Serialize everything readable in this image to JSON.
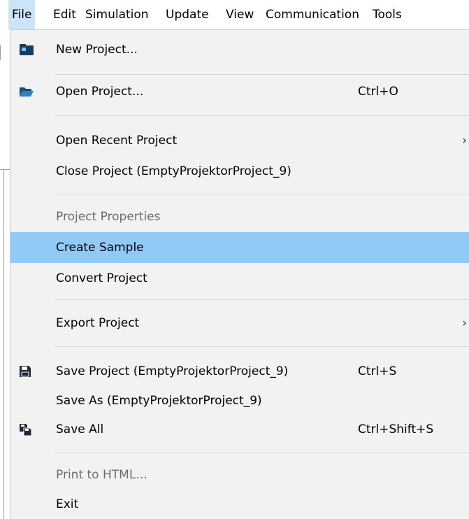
{
  "menubar": {
    "items": [
      {
        "label": "File"
      },
      {
        "label": "Edit"
      },
      {
        "label": "Simulation"
      },
      {
        "label": "Update"
      },
      {
        "label": "View"
      },
      {
        "label": "Communication"
      },
      {
        "label": "Tools"
      }
    ],
    "active_item": "File"
  },
  "file_menu": {
    "new_project": {
      "label": "New Project...",
      "icon": "new-project-icon"
    },
    "open_project": {
      "label": "Open Project...",
      "shortcut": "Ctrl+O",
      "icon": "folder-open-icon"
    },
    "open_recent_project": {
      "label": "Open Recent Project",
      "has_submenu": true
    },
    "close_project": {
      "label": "Close Project (EmptyProjektorProject_9)"
    },
    "project_properties": {
      "label": "Project Properties",
      "enabled": false
    },
    "create_sample": {
      "label": "Create Sample",
      "highlighted": true
    },
    "convert_project": {
      "label": "Convert Project"
    },
    "export_project": {
      "label": "Export Project",
      "has_submenu": true
    },
    "save_project": {
      "label": "Save Project (EmptyProjektorProject_9)",
      "shortcut": "Ctrl+S",
      "icon": "floppy-disk-icon"
    },
    "save_as": {
      "label": "Save As (EmptyProjektorProject_9)"
    },
    "save_all": {
      "label": "Save All",
      "shortcut": "Ctrl+Shift+S",
      "icon": "save-all-icon"
    },
    "print_to_html": {
      "label": "Print to HTML...",
      "enabled": false
    },
    "exit": {
      "label": "Exit"
    }
  },
  "colors": {
    "highlight": "#91c9f7",
    "menu_background": "#f2f2f2",
    "active_menubar_item": "#cce4f7",
    "disabled_text": "#6d6d6d"
  }
}
